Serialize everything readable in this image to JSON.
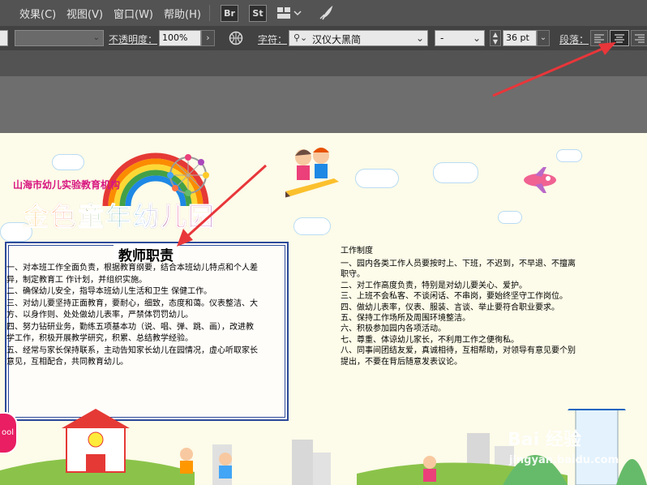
{
  "menu": {
    "items": [
      "效果(C)",
      "视图(V)",
      "窗口(W)",
      "帮助(H)"
    ],
    "app_icons": [
      "Br",
      "St"
    ]
  },
  "options": {
    "opacity_label": "不透明度：",
    "opacity_value": "100%",
    "char_label": "字符：",
    "font_value": "汉仪大黑简",
    "style_value": "-",
    "size_value": "36 pt",
    "para_label": "段落："
  },
  "poster": {
    "org": "山海市幼儿实验教育机构",
    "kindergarten": "金色童年幼儿园",
    "left_title": "教师职责",
    "left_lines": [
      "一、对本班工作全面负责，根据教育纲要，结合本班幼儿特点和个人差",
      "异，制定教育工 作计划，并组织实施。",
      "二、确保幼儿安全，指导本班幼儿生活和卫生 保健工作。",
      "三、对幼儿要坚持正面教育，要耐心，细致，态度和蔼。仪表整洁、大",
      "方、以身作则、处处做幼儿表率，严禁体罚罚幼儿。",
      "四、努力钻研业务，勤练五项基本功（说、唱、弹、跳、画），改进教",
      "学工作，积极开展教学研究，积累、总结教学经验。",
      "五、经常与家长保持联系，主动告知家长幼儿在园情况，虚心听取家长",
      "意见，互相配合，共同教育幼儿。"
    ],
    "right_title": "工作制度",
    "right_lines": [
      "一、园内各类工作人员要按时上、下班，不迟到，不早退、不擅离",
      "职守。",
      "二、对工作高度负责，特别是对幼儿要关心、爱护。",
      "三、上班不会私客、不谈闲话、不串岗，要始终坚守工作岗位。",
      "四、做幼儿表率，仪表、服装、言谈、举止要符合职业要求。",
      "五、保持工作场所及周围环境整洁。",
      "六、积极参加园内各项活动。",
      "七、尊重、体谅幼儿家长，不利用工作之便徇私。",
      "八、同事间团结友爱，真诚相待，互相帮助，对领导有意见要个别",
      "提出，不要在背后随意发表议论。"
    ],
    "school_badge": "ool"
  },
  "watermark": {
    "brand": "Bai 经验",
    "url": "jingyan.baidu.com"
  },
  "colors": {
    "arrow": "#e8363a",
    "panel_border": "#2c4a9a",
    "org_text": "#d8157f"
  }
}
